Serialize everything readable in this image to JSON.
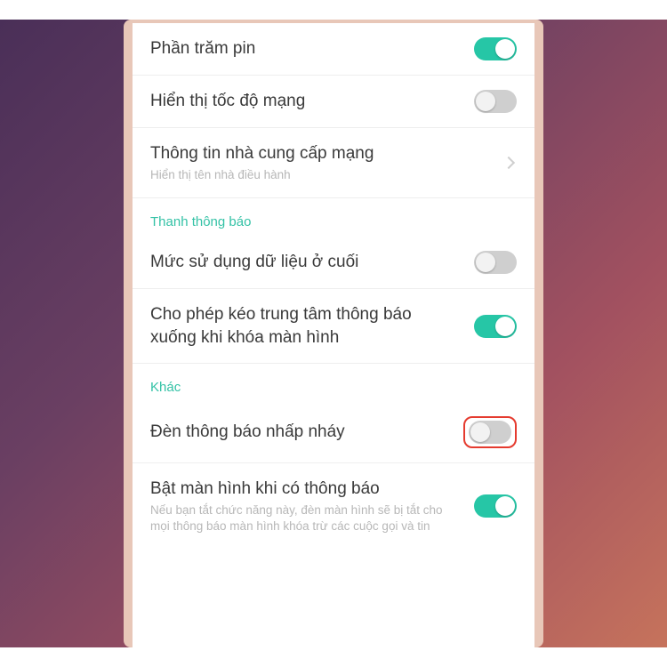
{
  "rows": {
    "battery_percent": {
      "title": "Phần trăm pin",
      "on": true
    },
    "network_speed": {
      "title": "Hiển thị tốc độ mạng",
      "on": false
    },
    "carrier_info": {
      "title": "Thông tin nhà cung cấp mạng",
      "sub": "Hiển thị tên nhà điều hành"
    },
    "section_notif": "Thanh thông báo",
    "data_usage_end": {
      "title": "Mức sử dụng dữ liệu ở cuối",
      "on": false
    },
    "pull_notif_lock": {
      "title": "Cho phép kéo trung tâm thông báo xuống khi khóa màn hình",
      "on": true
    },
    "section_other": "Khác",
    "led_blink": {
      "title": "Đèn thông báo nhấp nháy",
      "on": false,
      "highlighted": true
    },
    "wake_on_notif": {
      "title": "Bật màn hình khi có thông báo",
      "sub": "Nếu bạn tắt chức năng này, đèn màn hình sẽ bị tắt cho mọi thông báo màn hình khóa trừ các cuộc gọi và tin",
      "on": true
    }
  }
}
